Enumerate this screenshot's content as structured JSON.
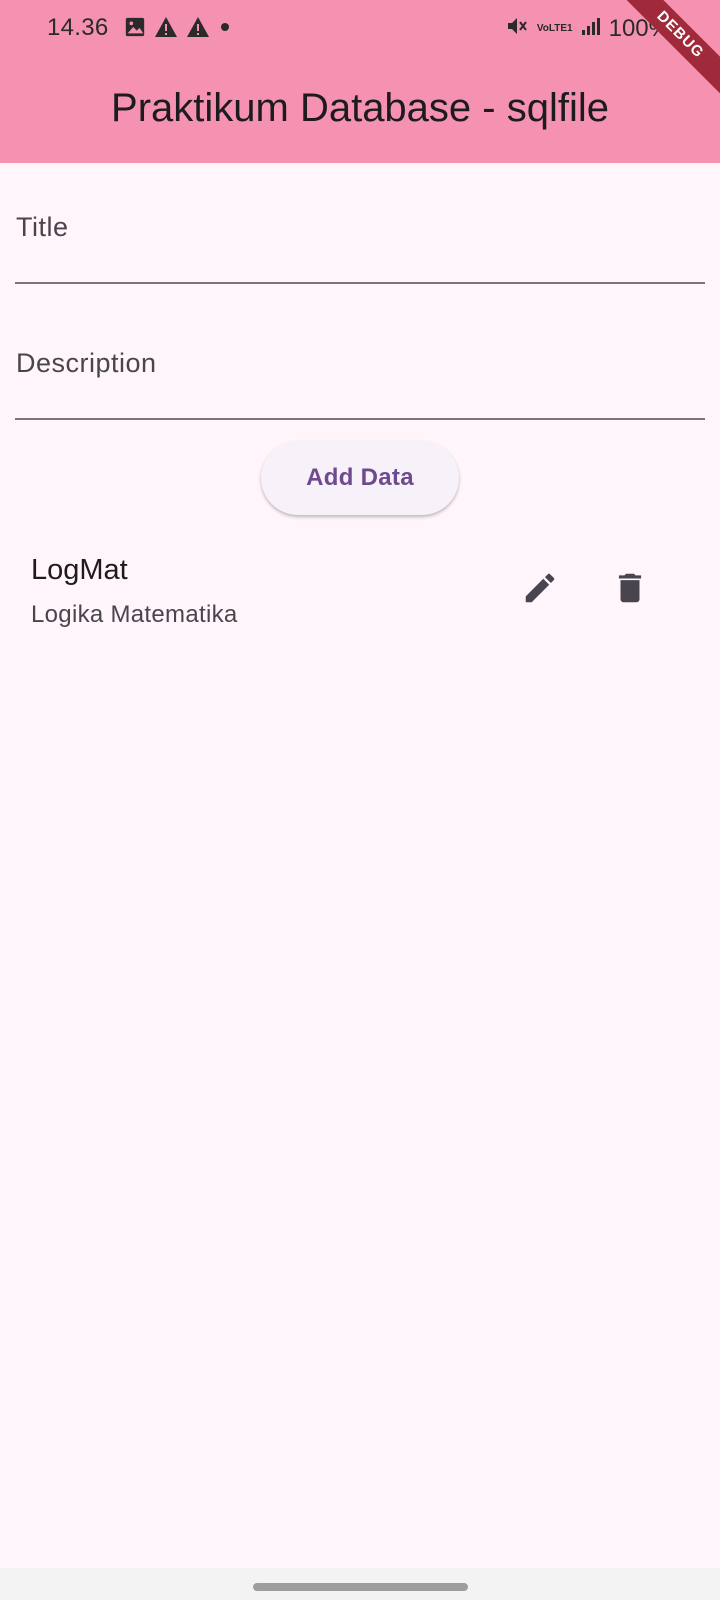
{
  "status_bar": {
    "time": "14.36",
    "battery_percent": "100%",
    "network_label": "VoLTE1",
    "icons": [
      "image-icon",
      "warning-icon",
      "warning-icon",
      "dot-icon",
      "mute-icon",
      "volte-icon",
      "signal-icon",
      "battery-icon"
    ]
  },
  "app_bar": {
    "title": "Praktikum Database - sqlfile",
    "debug_banner": "DEBUG"
  },
  "form": {
    "title_label": "Title",
    "title_value": "",
    "description_label": "Description",
    "description_value": "",
    "add_button_label": "Add Data"
  },
  "items": [
    {
      "title": "LogMat",
      "subtitle": "Logika Matematika",
      "edit_icon": "pencil-icon",
      "delete_icon": "trash-icon"
    }
  ],
  "colors": {
    "app_bar": "#f592b2",
    "background": "#fff5fa",
    "button_text": "#6f4a8e",
    "icon": "#49454f",
    "debug_ribbon": "#a02a3a"
  }
}
